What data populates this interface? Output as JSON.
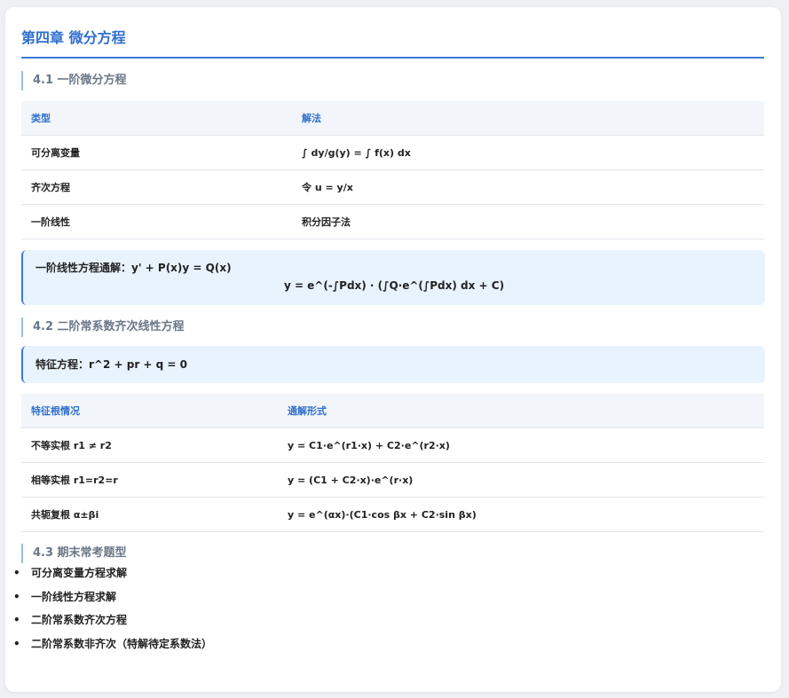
{
  "chapter": {
    "title": "第四章 微分方程"
  },
  "sections": {
    "s1": {
      "heading": "4.1 一阶微分方程",
      "table": {
        "headers": [
          "类型",
          "解法"
        ],
        "rows": [
          [
            "可分离变量",
            "∫ dy/g(y) = ∫ f(x) dx"
          ],
          [
            "齐次方程",
            "令 u = y/x"
          ],
          [
            "一阶线性",
            "积分因子法"
          ]
        ]
      },
      "note": {
        "line1": "一阶线性方程通解：y' + P(x)y = Q(x)",
        "line2": "y = e^(-∫Pdx) · (∫Q·e^(∫Pdx) dx + C)"
      }
    },
    "s2": {
      "heading": "4.2 二阶常系数齐次线性方程",
      "note": {
        "line1": "特征方程：r^2 + pr + q = 0"
      },
      "table": {
        "headers": [
          "特征根情况",
          "通解形式"
        ],
        "rows": [
          [
            "不等实根 r1 ≠ r2",
            "y = C1·e^(r1·x) + C2·e^(r2·x)"
          ],
          [
            "相等实根 r1=r2=r",
            "y = (C1 + C2·x)·e^(r·x)"
          ],
          [
            "共轭复根 α±βi",
            "y = e^(αx)·(C1·cos βx + C2·sin βx)"
          ]
        ]
      }
    },
    "s3": {
      "heading": "4.3 期末常考题型",
      "bullet": "•",
      "items": [
        "可分离变量方程求解",
        "一阶线性方程求解",
        "二阶常系数齐次方程",
        "二阶常系数非齐次（特解待定系数法）"
      ]
    }
  },
  "colors": {
    "accent": "#2f6fcf",
    "note_bg": "#e9f3fe",
    "header_bg": "#f2f5f9",
    "section_heading": "#6b7787"
  }
}
